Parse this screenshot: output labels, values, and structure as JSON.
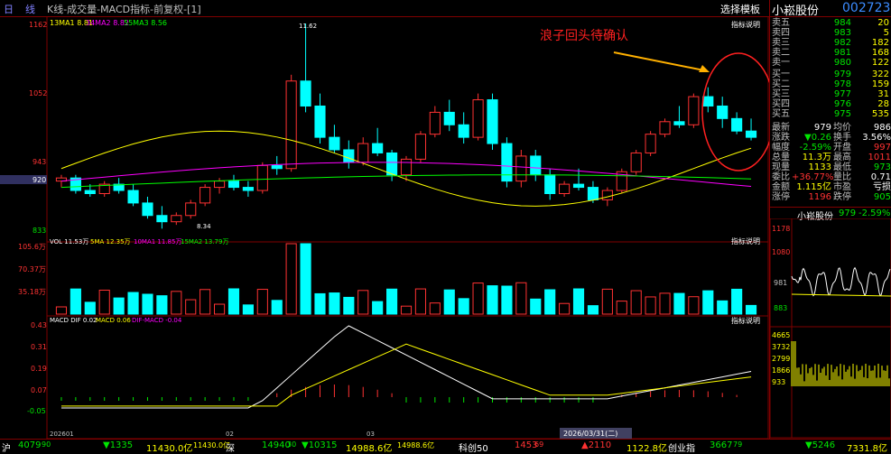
{
  "topbar": {
    "period_day": "日",
    "period_line": "线",
    "title": "K线-成交量-MACD指标-前复权-[1]",
    "template_button": "选择模板",
    "stock_name": "小崧股份",
    "stock_code": "002723"
  },
  "main_chart": {
    "ma_legend": [
      "13MA1 8.81",
      "34MA2 8.82",
      "55MA3 8.56"
    ],
    "ma_colors": [
      "#ffff00",
      "#ff00ff",
      "#00ff00"
    ],
    "price_axis": [
      "1162",
      "1052",
      "943",
      "920",
      "833"
    ],
    "indicator_label": "指标说明",
    "high_label": "11.62",
    "low_label": "8.34",
    "annotation": "浪子回头待确认",
    "annotation_color": "#ff2020"
  },
  "volume_chart": {
    "legend": [
      "VOL 11.53万",
      "5MA 12.35万",
      "10MA1 11.85万",
      "15MA2 13.79万"
    ],
    "axis": [
      "105.6万",
      "70.37万",
      "35.18万"
    ],
    "indicator_label": "指标说明"
  },
  "macd_chart": {
    "legend": [
      "MACD DIF 0.02",
      "MACD 0.06",
      "DIF-MACD -0.04"
    ],
    "axis": [
      "0.43",
      "0.31",
      "0.19",
      "0.07",
      "-0.05"
    ],
    "indicator_label": "指标说明",
    "x_labels": [
      "202601",
      "02",
      "03"
    ],
    "date_badge": "2026/03/31(二)"
  },
  "order_book": {
    "asks": [
      {
        "label": "卖五",
        "price": "984",
        "vol": "20"
      },
      {
        "label": "卖四",
        "price": "983",
        "vol": "5"
      },
      {
        "label": "卖三",
        "price": "982",
        "vol": "182"
      },
      {
        "label": "卖二",
        "price": "981",
        "vol": "168"
      },
      {
        "label": "卖一",
        "price": "980",
        "vol": "122"
      }
    ],
    "bids": [
      {
        "label": "买一",
        "price": "979",
        "vol": "322"
      },
      {
        "label": "买二",
        "price": "978",
        "vol": "159"
      },
      {
        "label": "买三",
        "price": "977",
        "vol": "31"
      },
      {
        "label": "买四",
        "price": "976",
        "vol": "28"
      },
      {
        "label": "买五",
        "price": "975",
        "vol": "535"
      }
    ]
  },
  "quote": [
    {
      "l1": "最新",
      "v1": "979",
      "c1": "#ffffff",
      "l2": "均价",
      "v2": "986",
      "c2": "#ffffff"
    },
    {
      "l1": "涨跌",
      "v1": "▼0.26",
      "c1": "#00e600",
      "l2": "换手",
      "v2": "3.56%",
      "c2": "#ffffff"
    },
    {
      "l1": "幅度",
      "v1": "-2.59%",
      "c1": "#00e600",
      "l2": "开盘",
      "v2": "997",
      "c2": "#ff3232"
    },
    {
      "l1": "总量",
      "v1": "11.3万",
      "c1": "#ffff00",
      "l2": "最高",
      "v2": "1011",
      "c2": "#ff3232"
    },
    {
      "l1": "现量",
      "v1": "1133",
      "c1": "#ffff00",
      "l2": "最低",
      "v2": "973",
      "c2": "#00e600"
    },
    {
      "l1": "委比",
      "v1": "+36.77%",
      "c1": "#ff3232",
      "l2": "量比",
      "v2": "0.71",
      "c2": "#ffffff"
    },
    {
      "l1": "金额",
      "v1": "1.115亿",
      "c1": "#ffff00",
      "l2": "市盈",
      "v2": "亏损",
      "c2": "#ffffff"
    },
    {
      "l1": "涨停",
      "v1": "1196",
      "c1": "#ff3232",
      "l2": "跌停",
      "v2": "905",
      "c2": "#00e600"
    }
  ],
  "mini_chart": {
    "name": "小崧股份",
    "price": "979",
    "change": "-2.59%",
    "price_axis": [
      "1178",
      "1080",
      "981",
      "883"
    ],
    "price_axis_bottom": [
      "981"
    ],
    "vol_axis": [
      "4665",
      "3732",
      "2799",
      "1866",
      "933"
    ]
  },
  "bottombar": {
    "sh_label": "沪",
    "sh_price": "4079",
    "sh_price_sup": "90",
    "sh_change": "▼1335",
    "sh_amount": "11430.0亿",
    "sh_amount2": "11430.0亿",
    "sz_label": "深",
    "sz_price": "14940",
    "sz_price_sup": "30",
    "sz_change": "▼10315",
    "sz_amount": "14988.6亿",
    "sz_amount2": "14988.6亿",
    "kc_label": "科创50",
    "kc_price": "1453",
    "kc_price_sup": "69",
    "kc_change": "▲2110",
    "kc_amount": "1122.8亿",
    "cy_label": "创业指",
    "cy_price": "3667",
    "cy_price_sup": "79",
    "cy_change": "▼5246",
    "cy_amount": "7331.8亿"
  }
}
